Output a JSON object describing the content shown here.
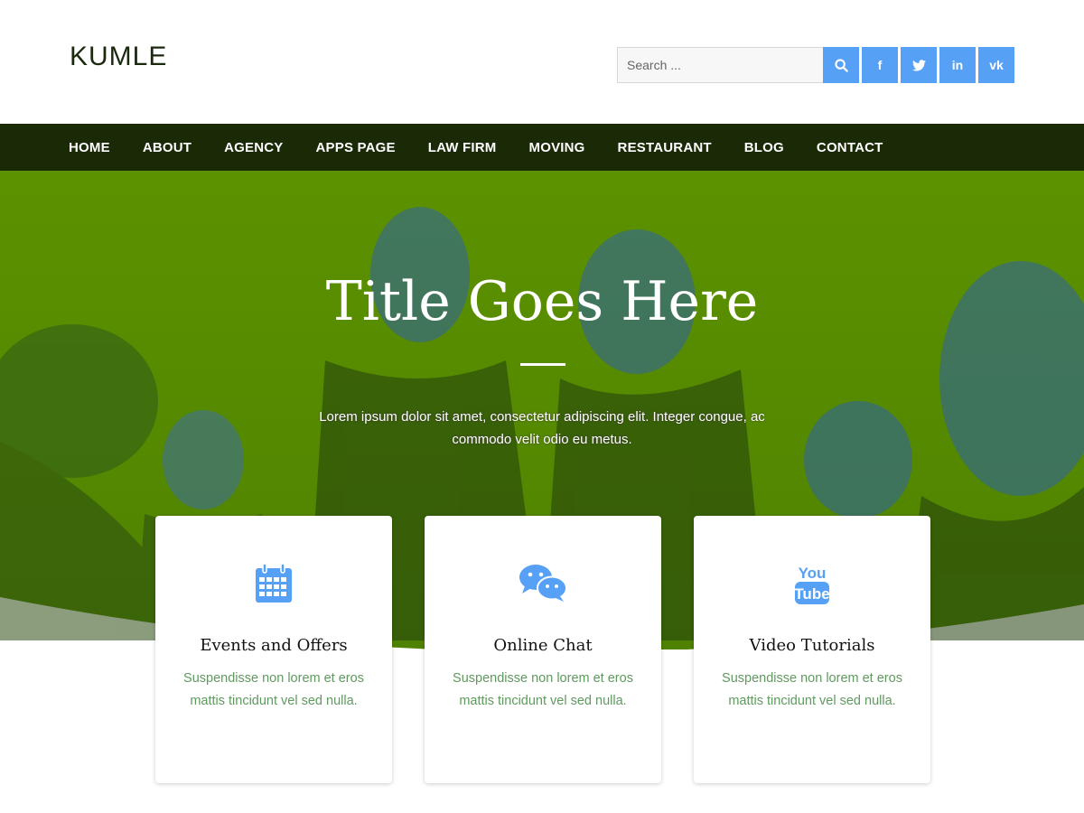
{
  "header": {
    "logo": "KUMLE",
    "search": {
      "placeholder": "Search ...",
      "button_icon": "search-icon"
    },
    "social": [
      {
        "name": "facebook",
        "label": "f"
      },
      {
        "name": "twitter",
        "label": "t"
      },
      {
        "name": "linkedin",
        "label": "in"
      },
      {
        "name": "vk",
        "label": "vk"
      }
    ]
  },
  "nav": {
    "items": [
      "HOME",
      "ABOUT",
      "AGENCY",
      "APPS PAGE",
      "LAW FIRM",
      "MOVING",
      "RESTAURANT",
      "BLOG",
      "CONTACT"
    ]
  },
  "hero": {
    "title": "Title Goes Here",
    "text": "Lorem ipsum dolor sit amet, consectetur adipiscing elit. Integer congue, ac commodo velit odio eu metus."
  },
  "cards": [
    {
      "title": "Events and Offers",
      "text": "Suspendisse non lorem et eros mattis tincidunt vel sed nulla.",
      "icon": "calendar-icon"
    },
    {
      "title": "Online Chat",
      "text": "Suspendisse non lorem et eros mattis tincidunt vel sed nulla.",
      "icon": "chat-icon"
    },
    {
      "title": "Video Tutorials",
      "text": "Suspendisse non lorem et eros mattis tincidunt vel sed nulla.",
      "icon": "youtube-icon"
    }
  ],
  "colors": {
    "accent": "#56a0f5",
    "nav_bg": "#1a2a07",
    "hero_green": "#5e9400",
    "card_text": "#5f9a5f"
  }
}
